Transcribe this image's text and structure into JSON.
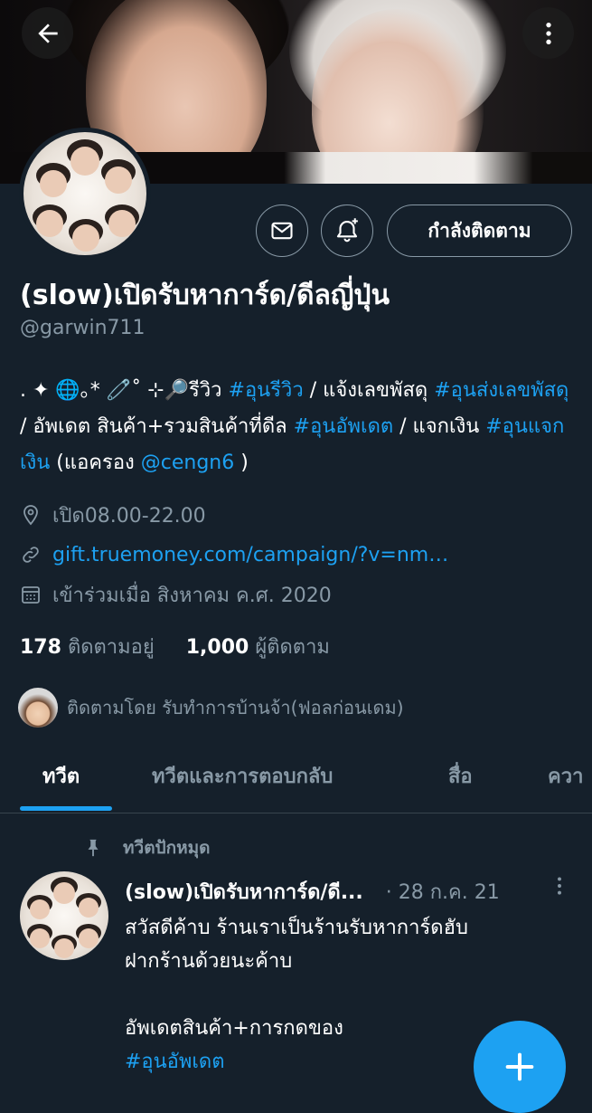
{
  "header": {
    "display_name": "(slow)เปิดรับหาการ์ด/ดีลญี่ปุ่น",
    "handle": "@garwin711",
    "follow_button": "กำลังติดตาม"
  },
  "bio": {
    "part1": ". ✦ 🌐｡* 🧷˚ ⊹🔎รีวิว ",
    "tag1": "#อุนรีวิว",
    "part2": " / แจ้งเลขพัสดุ ",
    "tag2": "#อุนส่งเลขพัสดุ",
    "part3": " / อัพเดต สินค้า+รวมสินค้าที่ดีล ",
    "tag3": "#อุนอัพเดต",
    "part4": " / แจกเงิน ",
    "tag4": "#อุนแจกเงิน",
    "part5": " (แอครอง ",
    "mention": "@cengn6",
    "part6": " )"
  },
  "meta": {
    "location": "เปิด08.00-22.00",
    "link": "gift.truemoney.com/campaign/?v=nm…",
    "joined": "เข้าร่วมเมื่อ สิงหาคม ค.ศ. 2020"
  },
  "stats": {
    "following_count": "178",
    "following_label": "ติดตามอยู่",
    "followers_count": "1,000",
    "followers_label": "ผู้ติดตาม"
  },
  "followed_by": "ติดตามโดย รับทำการบ้านจ้า(ฟอลก่อนเดม)",
  "tabs": [
    {
      "label": "ทวีต"
    },
    {
      "label": "ทวีตและการตอบกลับ"
    },
    {
      "label": "สื่อ"
    },
    {
      "label": "ควา"
    }
  ],
  "pinned_tweet": {
    "label": "ทวีตปักหมุด",
    "author": "(slow)เปิดรับหาการ์ด/ดี...",
    "date": "· 28 ก.ค. 21",
    "line1": "สวัสดีค้าบ ร้านเราเป็นร้านรับหาการ์ดฮับ",
    "line2": "ฝากร้านด้วยนะค้าบ",
    "line3": "อัพเดตสินค้า+การกดของ",
    "tag": "#อุนอัพเดต"
  },
  "colors": {
    "background": "#15202b",
    "accent": "#1da1f2",
    "secondary_text": "#8899a6"
  }
}
